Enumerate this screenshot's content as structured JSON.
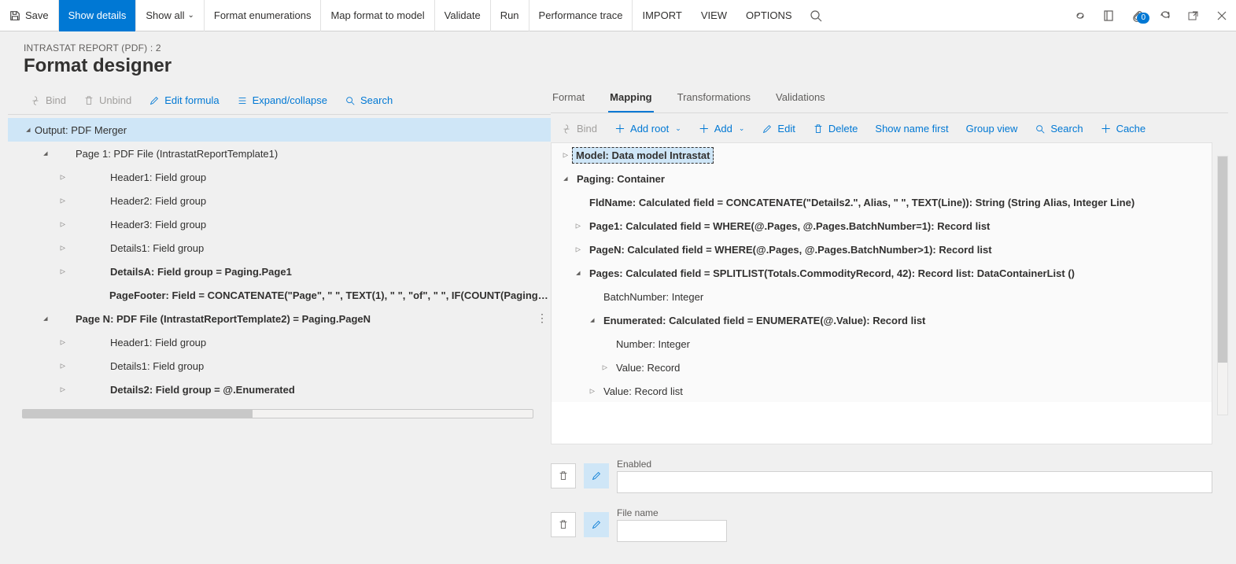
{
  "actionPane": {
    "save": "Save",
    "showDetails": "Show details",
    "showAll": "Show all",
    "formatEnum": "Format enumerations",
    "mapFormat": "Map format to model",
    "validate": "Validate",
    "run": "Run",
    "perfTrace": "Performance trace",
    "import": "IMPORT",
    "view": "VIEW",
    "options": "OPTIONS",
    "badge": "0"
  },
  "header": {
    "breadcrumb": "INTRASTAT REPORT (PDF) : 2",
    "title": "Format designer"
  },
  "leftToolbar": {
    "bind": "Bind",
    "unbind": "Unbind",
    "editFormula": "Edit formula",
    "expandCollapse": "Expand/collapse",
    "search": "Search"
  },
  "leftTree": [
    {
      "level": 1,
      "caret": "exp",
      "bold": false,
      "sel": true,
      "text": "Output: PDF Merger"
    },
    {
      "level": 2,
      "caret": "exp",
      "bold": false,
      "text": "Page 1: PDF File (IntrastatReportTemplate1)"
    },
    {
      "level": 3,
      "caret": "col",
      "bold": false,
      "text": "Header1: Field group"
    },
    {
      "level": 3,
      "caret": "col",
      "bold": false,
      "text": "Header2: Field group"
    },
    {
      "level": 3,
      "caret": "col",
      "bold": false,
      "text": "Header3: Field group"
    },
    {
      "level": 3,
      "caret": "col",
      "bold": false,
      "text": "Details1: Field group"
    },
    {
      "level": 3,
      "caret": "col",
      "bold": true,
      "text": "DetailsA: Field group = Paging.Page1"
    },
    {
      "level": 3,
      "caret": "none",
      "bold": true,
      "text": "PageFooter: Field = CONCATENATE(\"Page\", \" \", TEXT(1), \" \", \"of\", \" \", IF(COUNT(Paging.Pages)>"
    },
    {
      "level": 2,
      "caret": "exp",
      "bold": true,
      "text": "Page N: PDF File (IntrastatReportTemplate2) = Paging.PageN",
      "more": true
    },
    {
      "level": 3,
      "caret": "col",
      "bold": false,
      "text": "Header1: Field group"
    },
    {
      "level": 3,
      "caret": "col",
      "bold": false,
      "text": "Details1: Field group"
    },
    {
      "level": 3,
      "caret": "col",
      "bold": true,
      "text": "Details2: Field group = @.Enumerated"
    }
  ],
  "rightTabs": {
    "format": "Format",
    "mapping": "Mapping",
    "transformations": "Transformations",
    "validations": "Validations"
  },
  "rightToolbar": {
    "bind": "Bind",
    "addRoot": "Add root",
    "add": "Add",
    "edit": "Edit",
    "delete": "Delete",
    "showNameFirst": "Show name first",
    "groupView": "Group view",
    "search": "Search",
    "cache": "Cache"
  },
  "rightTree": [
    {
      "level": 1,
      "caret": "col",
      "selbox": true,
      "bold": true,
      "text": "Model: Data model Intrastat"
    },
    {
      "level": 1,
      "caret": "exp",
      "bold": true,
      "text": "Paging: Container"
    },
    {
      "level": 2,
      "caret": "none",
      "bold": true,
      "text": "FldName: Calculated field = CONCATENATE(\"Details2.\", Alias, \" \", TEXT(Line)): String (String Alias, Integer Line)"
    },
    {
      "level": 2,
      "caret": "col",
      "bold": true,
      "text": "Page1: Calculated field = WHERE(@.Pages, @.Pages.BatchNumber=1): Record list"
    },
    {
      "level": 2,
      "caret": "col",
      "bold": true,
      "text": "PageN: Calculated field = WHERE(@.Pages, @.Pages.BatchNumber>1): Record list"
    },
    {
      "level": 2,
      "caret": "exp",
      "bold": true,
      "text": "Pages: Calculated field = SPLITLIST(Totals.CommodityRecord, 42): Record list: DataContainerList ()"
    },
    {
      "level": 3,
      "caret": "none",
      "bold": false,
      "text": "BatchNumber: Integer"
    },
    {
      "level": 3,
      "caret": "exp",
      "bold": true,
      "text": "Enumerated: Calculated field = ENUMERATE(@.Value): Record list"
    },
    {
      "level": 4,
      "caret": "none",
      "bold": false,
      "text": "Number: Integer"
    },
    {
      "level": 4,
      "caret": "col",
      "bold": false,
      "text": "Value: Record"
    },
    {
      "level": 3,
      "caret": "col",
      "bold": false,
      "text": "Value: Record list"
    }
  ],
  "fields": {
    "enabled": {
      "label": "Enabled",
      "value": ""
    },
    "fileName": {
      "label": "File name",
      "value": ""
    }
  }
}
